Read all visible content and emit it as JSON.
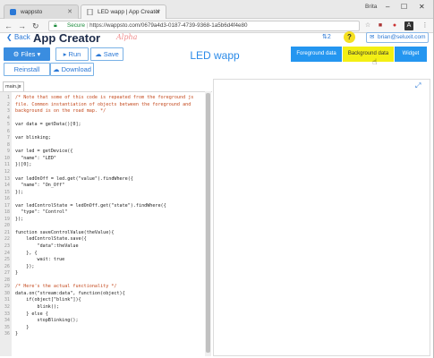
{
  "browser": {
    "tabs": [
      {
        "label": "wappsto"
      },
      {
        "label": "LED wapp | App Creator"
      }
    ],
    "window_user": "Brita",
    "secure_label": "Secure",
    "url": "https://wappsto.com/0679a4d3-0187-4739-9368-1a5b6d4f4e80"
  },
  "header": {
    "back": "Back",
    "title": "App Creator",
    "badge": "Alpha",
    "notifications": "2",
    "help": "?",
    "user": "brian@seluxit.com"
  },
  "toolbar": {
    "files": "Files",
    "run": "Run",
    "save": "Save",
    "reinstall": "Reinstall",
    "download": "Download"
  },
  "app_name": "LED wapp",
  "views": {
    "foreground": "Foreground data",
    "background": "Background data",
    "widget": "Widget"
  },
  "editor": {
    "file_tab": "main.js",
    "lines": [
      "/* Note that some of this code is repeated from the foreground js",
      "file. Common instantiation of objects between the foreground and",
      "background is on the road map. */",
      "",
      "var data = getData()[0];",
      "",
      "var blinking;",
      "",
      "var led = getDevice({",
      "  \"name\": \"LED\"",
      "})[0];",
      "",
      "var ledOnOff = led.get(\"value\").findWhere({",
      "  \"name\": \"On_Off\"",
      "});",
      "",
      "var ledControlState = ledOnOff.get(\"state\").findWhere({",
      "  \"type\": \"Control\"",
      "});",
      "",
      "function saveControlValue(theValue){",
      "    ledControlState.save({",
      "        \"data\":theValue",
      "    }, {",
      "        wait: true",
      "    });",
      "}",
      "",
      "/* Here's the actual functionality */",
      "data.on(\"stream:data\", function(object){",
      "    if(object[\"blink\"]){",
      "        blink();",
      "    } else {",
      "        stopBlinking();",
      "    }",
      "}"
    ]
  },
  "colors": {
    "accent": "#2496f0",
    "active_view": "#f3ef14",
    "title": "#1d2b4a",
    "badge": "#f08a8a"
  }
}
